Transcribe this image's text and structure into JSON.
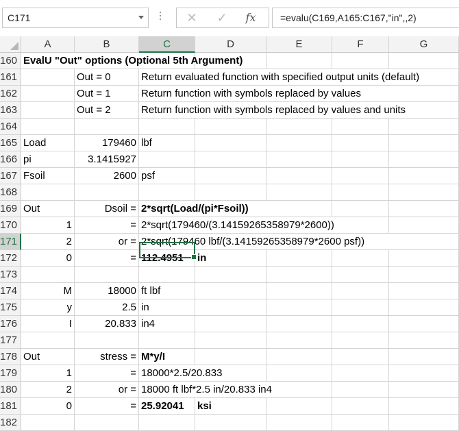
{
  "name_box": "C171",
  "formula_bar": {
    "cancel_glyph": "✕",
    "enter_glyph": "✓",
    "fx_label": "fx",
    "formula": "=evalu(C169,A165:C167,\"in\",,2)"
  },
  "columns": [
    "A",
    "B",
    "C",
    "D",
    "E",
    "F",
    "G"
  ],
  "selected_column": "C",
  "selected_row": "171",
  "rows": [
    {
      "num": "160",
      "A": "EvalU \"Out\" options (Optional 5th Argument)",
      "B": "",
      "C": "",
      "bold": [
        "A"
      ]
    },
    {
      "num": "161",
      "A": "",
      "B": "Out = 0",
      "C": "Return evaluated function with specified output units (default)"
    },
    {
      "num": "162",
      "A": "",
      "B": "Out = 1",
      "C": "Return function with symbols replaced by values"
    },
    {
      "num": "163",
      "A": "",
      "B": "Out = 2",
      "C": "Return function with symbols replaced by values and units"
    },
    {
      "num": "164",
      "A": "",
      "B": "",
      "C": ""
    },
    {
      "num": "165",
      "A": "Load",
      "B": "179460",
      "C": "lbf"
    },
    {
      "num": "166",
      "A": "pi",
      "B": "3.1415927",
      "C": ""
    },
    {
      "num": "167",
      "A": "Fsoil",
      "B": "2600",
      "C": "psf"
    },
    {
      "num": "168",
      "A": "",
      "B": "",
      "C": ""
    },
    {
      "num": "169",
      "A": "Out",
      "B": "Dsoil =",
      "C": " 2*sqrt(Load/(pi*Fsoil))",
      "bold": [
        "C"
      ]
    },
    {
      "num": "170",
      "A": "1",
      "B": "=",
      "C": "2*sqrt(179460/(3.14159265358979*2600))"
    },
    {
      "num": "171",
      "A": "2",
      "B": "or =",
      "C": "2*sqrt(179460 lbf/(3.14159265358979*2600 psf))"
    },
    {
      "num": "172",
      "A": "0",
      "B": "=",
      "C": "112.4951",
      "D": "in",
      "bold": [
        "C",
        "D"
      ]
    },
    {
      "num": "173",
      "A": "",
      "B": "",
      "C": ""
    },
    {
      "num": "174",
      "A": "M",
      "B": "18000",
      "C": "ft lbf"
    },
    {
      "num": "175",
      "A": "y",
      "B": "2.5",
      "C": "in"
    },
    {
      "num": "176",
      "A": "I",
      "B": "20.833",
      "C": "in4"
    },
    {
      "num": "177",
      "A": "",
      "B": "",
      "C": ""
    },
    {
      "num": "178",
      "A": "Out",
      "B": "stress =",
      "C": "M*y/I",
      "bold": [
        "C"
      ]
    },
    {
      "num": "179",
      "A": "1",
      "B": "=",
      "C": "18000*2.5/20.833"
    },
    {
      "num": "180",
      "A": "2",
      "B": "or =",
      "C": "18000 ft lbf*2.5 in/20.833 in4"
    },
    {
      "num": "181",
      "A": "0",
      "B": "=",
      "C": "25.92041",
      "D": "ksi",
      "bold": [
        "C",
        "D"
      ]
    },
    {
      "num": "182",
      "A": "",
      "B": "",
      "C": ""
    }
  ]
}
